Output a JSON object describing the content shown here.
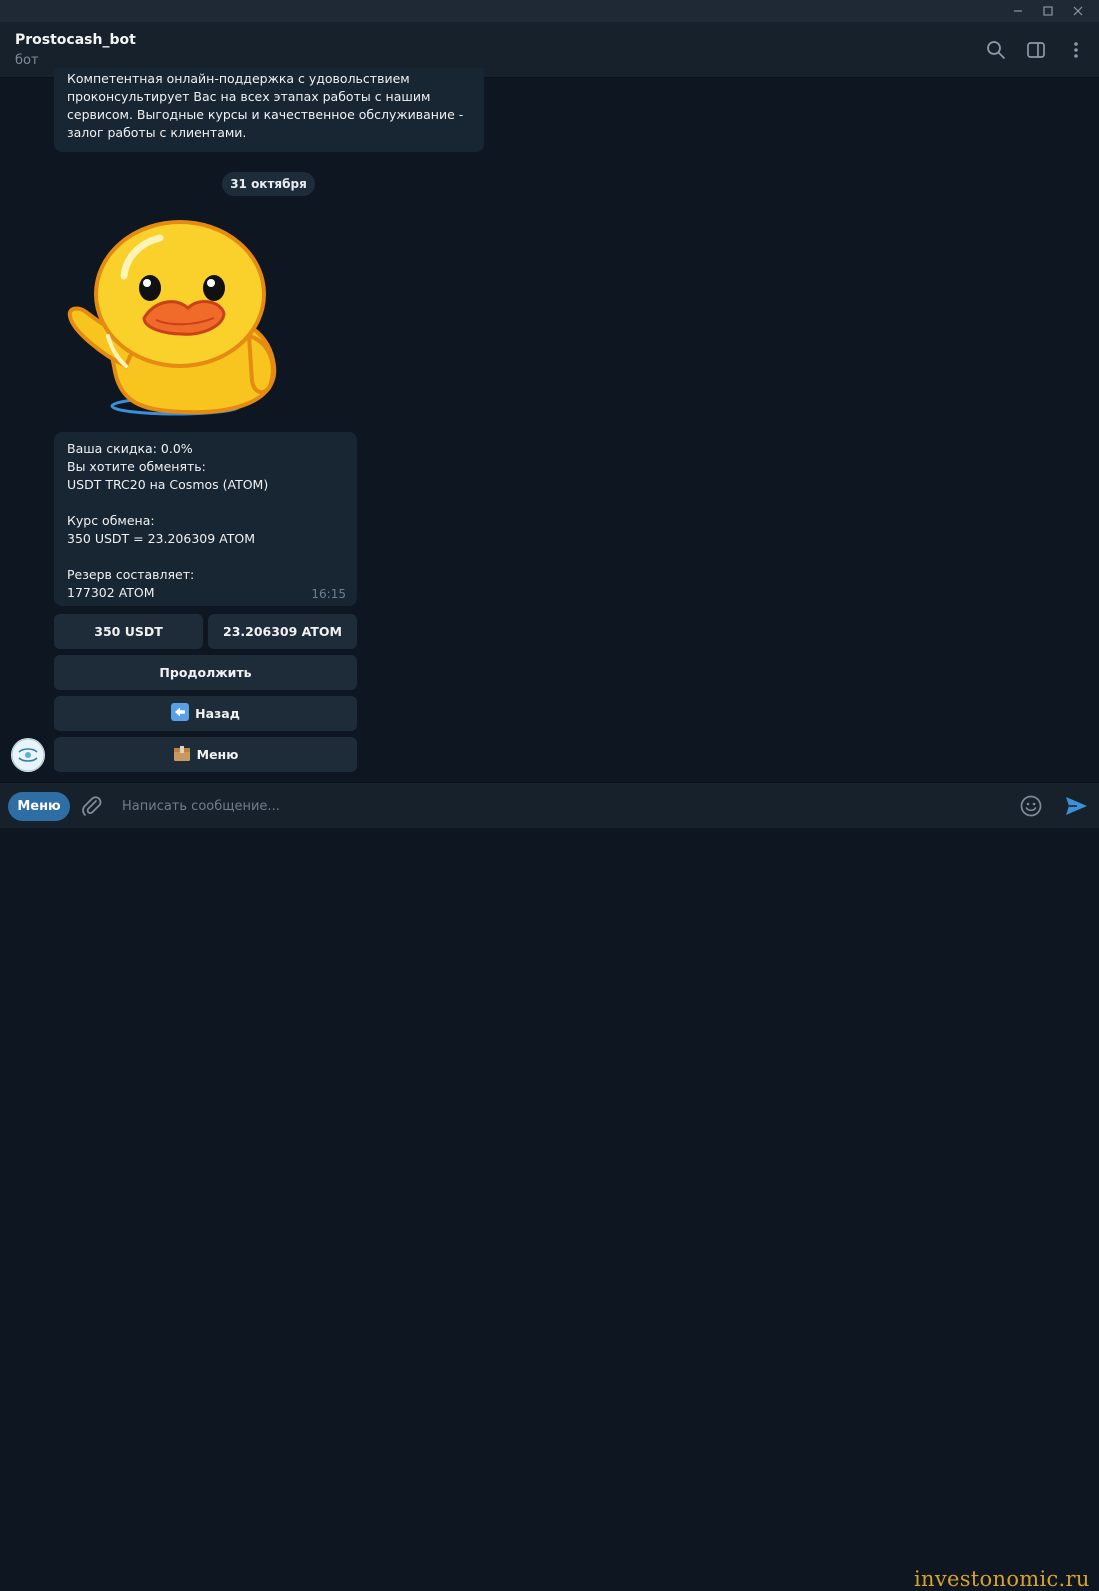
{
  "header": {
    "title": "Prostocash_bot",
    "subtitle": "бот"
  },
  "messages": {
    "intro_lines": [
      "Компетентная онлайн-поддержка с удовольствием",
      "проконсультирует Вас на всех этапах работы с нашим",
      "сервисом. Выгодные курсы и качественное обслуживание -",
      "залог работы с клиентами."
    ],
    "date_separator": "31 октября",
    "main_lines": [
      "Ваша скидка: 0.0%",
      "Вы хотите обменять:",
      "USDT TRC20 на Cosmos (ATOM)",
      "",
      "Курс обмена:",
      "350 USDT = 23.206309 ATOM",
      "",
      "Резерв составляет:",
      "177302 ATOM"
    ],
    "main_time": "16:15"
  },
  "keyboard": {
    "amount_from": "350 USDT",
    "amount_to": "23.206309 ATOM",
    "continue": "Продолжить",
    "back": "Назад",
    "menu": "Меню"
  },
  "composer": {
    "menu_label": "Меню",
    "placeholder": "Написать сообщение..."
  },
  "watermark": "investonomic.ru",
  "colors": {
    "background": "#0e1621",
    "bubble": "#182533",
    "panel": "#17212b",
    "accent": "#2f6ea5",
    "watermark": "#d7a22a"
  }
}
